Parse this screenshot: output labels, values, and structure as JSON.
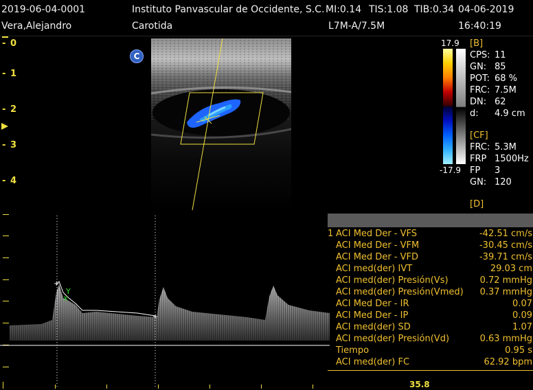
{
  "header": {
    "patient_id": "2019-06-04-0001",
    "institution": "Instituto Panvascular de Occidente, S.C.",
    "mi": "MI:0.14",
    "tis": "TIS:1.08",
    "tib": "TIB:0.34",
    "date": "04-06-2019",
    "patient_name": "Vera,Alejandro",
    "exam": "Carotida",
    "probe": "L7M-A/7.5M",
    "time": "16:40:19"
  },
  "depth_scale": [
    "0",
    "1",
    "2",
    "3",
    "4"
  ],
  "mode_badge": "C",
  "colorbar": {
    "max": "17.9",
    "min": "-17.9"
  },
  "b_params": {
    "title": "[B]",
    "rows": [
      {
        "key": "CPS:",
        "val": "11"
      },
      {
        "key": "GN:",
        "val": "85"
      },
      {
        "key": "POT:",
        "val": "68 %"
      },
      {
        "key": "FRC:",
        "val": "7.5M"
      },
      {
        "key": "DN:",
        "val": "62"
      },
      {
        "key": "d:",
        "val": "4.9 cm"
      }
    ]
  },
  "cf_params": {
    "title": "[CF]",
    "rows": [
      {
        "key": "FRC:",
        "val": "5.3M"
      },
      {
        "key": "FRP",
        "val": "1500Hz"
      },
      {
        "key": "FP",
        "val": "3"
      },
      {
        "key": "GN:",
        "val": "120"
      }
    ]
  },
  "d_params": {
    "title": "[D]"
  },
  "measurements": [
    {
      "num": "1",
      "label": "ACI Med Der - VFS",
      "value": "-42.51 cm/s"
    },
    {
      "num": "",
      "label": "ACI Med Der - VFM",
      "value": "-30.45 cm/s"
    },
    {
      "num": "",
      "label": "ACI Med Der - VFD",
      "value": "-39.71 cm/s"
    },
    {
      "num": "",
      "label": "ACI med(der) IVT",
      "value": "29.03 cm"
    },
    {
      "num": "",
      "label": "ACI med(der) Presión(Vs)",
      "value": "0.72 mmHg"
    },
    {
      "num": "",
      "label": "ACI med(der) Presión(Vmed)",
      "value": "0.37 mmHg"
    },
    {
      "num": "",
      "label": "ACI Med Der - IR",
      "value": "0.07"
    },
    {
      "num": "",
      "label": "ACI Med Der - IP",
      "value": "0.09"
    },
    {
      "num": "",
      "label": "ACI med(der) SD",
      "value": "1.07"
    },
    {
      "num": "",
      "label": "ACI med(der) Presión(Vd)",
      "value": "0.63 mmHg"
    },
    {
      "num": "",
      "label": "Tiempo",
      "value": "0.95 s"
    },
    {
      "num": "",
      "label": "ACI med(der) FC",
      "value": "62.92 bpm"
    }
  ],
  "sweep_readout": "35.8",
  "colors": {
    "accent_yellow": "#f0e040",
    "label_orange": "#f0c030",
    "flow_blue": "#1e64ff"
  }
}
